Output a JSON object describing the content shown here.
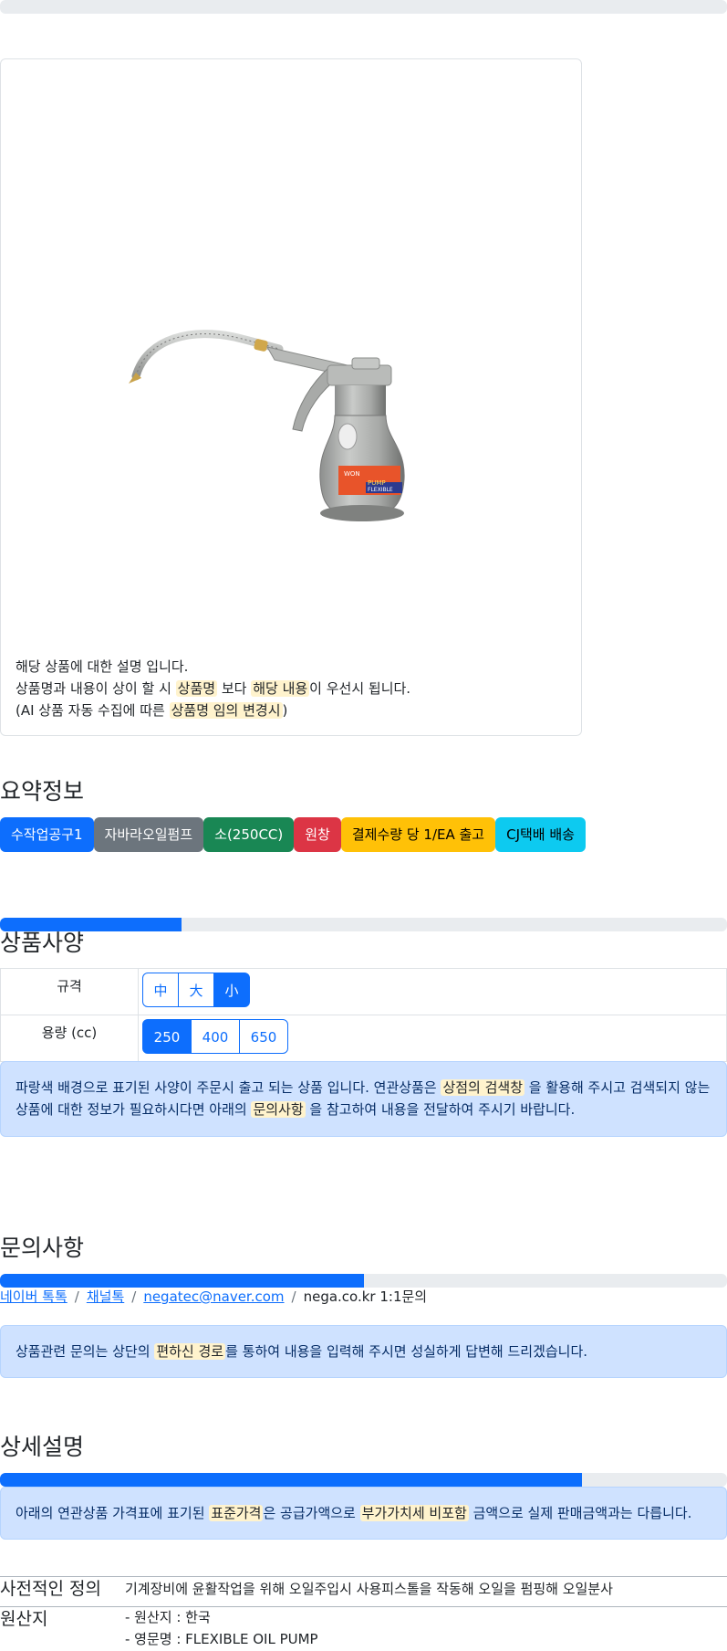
{
  "colors": {
    "primary": "#0d6efd",
    "secondary": "#6c757d",
    "success": "#198754",
    "danger": "#dc3545",
    "warning": "#ffc107",
    "info": "#0dcaf0",
    "alert_bg": "#cfe2ff",
    "highlight": "#fff3cd"
  },
  "product": {
    "image_alt": "oil pump",
    "pump_label_lines": [
      "WON",
      "PUMP",
      "FLEXIBLE"
    ],
    "desc_line1": "해당 상품에 대한 설명 입니다.",
    "desc_line2_a": "상품명과 내용이 상이 할 시 ",
    "desc_line2_b": "상품명",
    "desc_line2_c": " 보다 ",
    "desc_line2_d": "해당 내용",
    "desc_line2_e": "이 우선시 됩니다.",
    "desc_line3_a": "(AI 상품 자동 수집에 따른 ",
    "desc_line3_b": "상품명 임의 변경시",
    "desc_line3_c": ")"
  },
  "summary": {
    "title": "요약정보",
    "badges": [
      "수작업공구1",
      "자바라오일펌프",
      "소(250CC)",
      "원창",
      "결제수량 당 1/EA 출고",
      "CJ택배 배송"
    ]
  },
  "progress": {
    "top": 0,
    "spec": 0.25,
    "inquiry": 0.5,
    "detail": 0.8
  },
  "spec": {
    "title": "상품사양",
    "rows": [
      {
        "label": "규격",
        "options": [
          "中",
          "大",
          "小"
        ],
        "selected": 2
      },
      {
        "label": "용량 (cc)",
        "options": [
          "250",
          "400",
          "650"
        ],
        "selected": 0
      }
    ],
    "notice_a": "파랑색 배경으로 표기된 사양이 주문시 출고 되는 상품 입니다. 연관상품은 ",
    "notice_b": "상점의 검색창",
    "notice_c": " 을 활용해 주시고 검색되지 않는",
    "notice_d": "상품에 대한 정보가 필요하시다면 아래의 ",
    "notice_e": "문의사항",
    "notice_f": " 을 참고하여 내용을 전달하여 주시기 바랍니다."
  },
  "inquiry": {
    "title": "문의사항",
    "link1": "네이버 톡톡",
    "link2": "채널톡",
    "link3": "negatec@naver.com",
    "text4": "nega.co.kr 1:1문의",
    "separator": "/",
    "notice_a": "상품관련 문의는 상단의 ",
    "notice_b": "편하신 경로",
    "notice_c": "를 통하여 내용을 입력해 주시면 성실하게 답변해 드리겠습니다."
  },
  "detail": {
    "title": "상세설명",
    "notice_a": "아래의 연관상품 가격표에 표기된 ",
    "notice_b": "표준가격",
    "notice_c": "은 공급가액으로 ",
    "notice_d": "부가가치세 비포함",
    "notice_e": " 금액으로 실제 판매금액과는 다릅니다.",
    "def_term": "사전적인 정의",
    "def_value": "기계장비에 윤활작업을 위해 오일주입시 사용피스톨을 작동해 오일을 펌핑해 오일분사",
    "origin_term": "원산지",
    "origin_line1": "- 원산지 : 한국",
    "origin_line2": "- 영문명 : FLEXIBLE OIL PUMP"
  }
}
